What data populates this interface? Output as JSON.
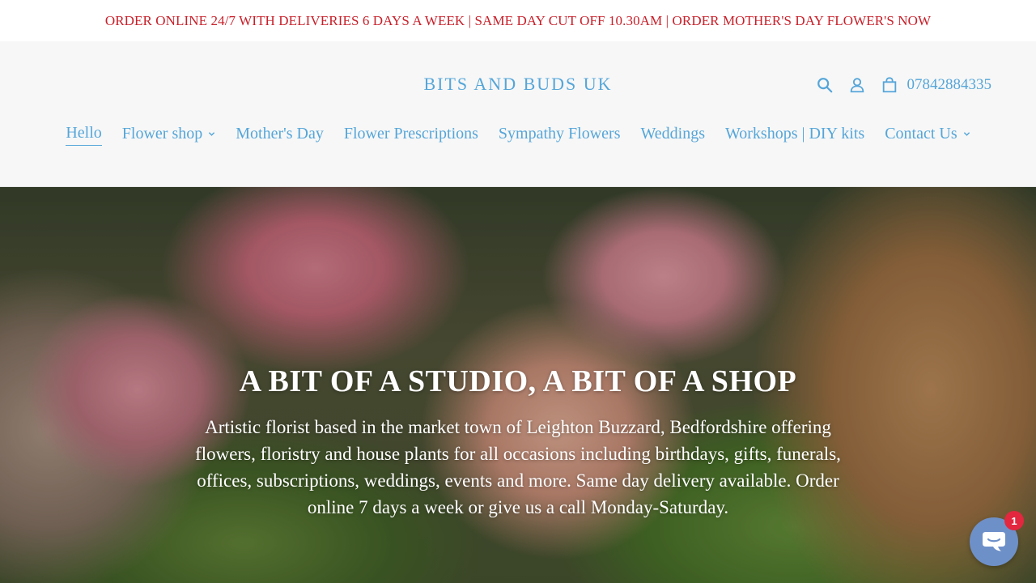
{
  "announcement": {
    "text": "ORDER ONLINE 24/7 WITH DELIVERIES 6 DAYS A WEEK | SAME DAY CUT OFF 10.30AM | ORDER MOTHER'S DAY FLOWER'S NOW"
  },
  "header": {
    "logo": "BITS AND BUDS UK",
    "phone": "07842884335",
    "icons": [
      "search-icon",
      "account-icon",
      "cart-icon"
    ]
  },
  "nav": {
    "items": [
      {
        "label": "Hello",
        "active": true,
        "dropdown": false
      },
      {
        "label": "Flower shop",
        "active": false,
        "dropdown": true
      },
      {
        "label": "Mother's Day",
        "active": false,
        "dropdown": false
      },
      {
        "label": "Flower Prescriptions",
        "active": false,
        "dropdown": false
      },
      {
        "label": "Sympathy Flowers",
        "active": false,
        "dropdown": false
      },
      {
        "label": "Weddings",
        "active": false,
        "dropdown": false
      },
      {
        "label": "Workshops | DIY kits",
        "active": false,
        "dropdown": false
      },
      {
        "label": "Contact Us",
        "active": false,
        "dropdown": true
      }
    ]
  },
  "hero": {
    "title": "A BIT OF A STUDIO, A BIT OF A SHOP",
    "text": "Artistic florist based in the market town of Leighton Buzzard, Bedfordshire offering flowers, floristry and house plants for all occasions including birthdays, gifts, funerals, offices, subscriptions, weddings, events and more. Same day delivery available. Order online 7 days a week or give us a call Monday-Saturday."
  },
  "chat": {
    "badge": "1",
    "icon": "chat-icon"
  },
  "colors": {
    "accent": "#55a6d9",
    "announcement": "#c8202a",
    "header_bg": "#f7f7f7",
    "chat_button": "#6e90c9",
    "badge": "#e2273f"
  }
}
